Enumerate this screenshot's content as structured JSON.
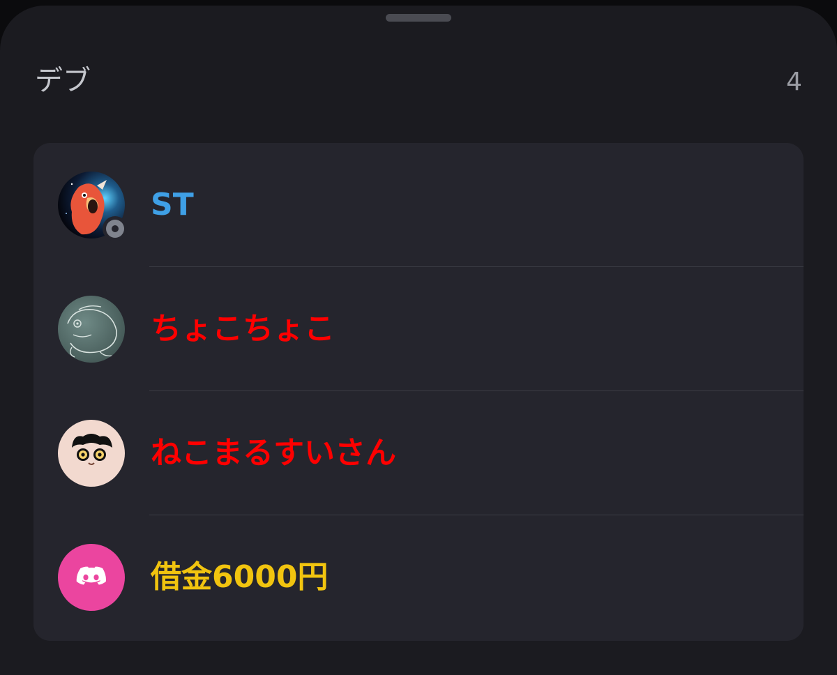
{
  "header": {
    "title": "デブ",
    "count": "4"
  },
  "members": [
    {
      "name": "ST",
      "color": "#3fa0e6",
      "avatar": "red-bird-avatar",
      "status": "offline"
    },
    {
      "name": "ちょこちょこ",
      "color": "#ff0000",
      "avatar": "frog-sketch-avatar"
    },
    {
      "name": "ねこまるすいさん",
      "color": "#ff0000",
      "avatar": "cartoon-face-avatar"
    },
    {
      "name": "借金6000円",
      "color": "#f1c40f",
      "avatar": "discord-default-avatar"
    }
  ]
}
